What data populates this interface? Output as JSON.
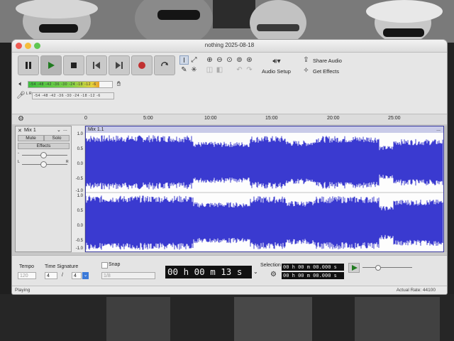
{
  "window": {
    "title": "nothing 2025-08-18"
  },
  "transport": {
    "pause": "pause-icon",
    "play": "play-icon",
    "stop": "stop-icon",
    "skip_start": "skip-start-icon",
    "skip_end": "skip-end-icon",
    "record": "record-icon",
    "loop": "loop-icon"
  },
  "toolbar": {
    "audio_setup_label": "Audio Setup",
    "share_audio_label": "Share Audio",
    "get_effects_label": "Get Effects"
  },
  "meters": {
    "playback_ticks": "-54 -48 -42 -36 -30 -24 -18 -12 -6",
    "record_ticks": "-54 -48 -42 -36 -30 -24 -18 -12 -6",
    "playback_level": 0.85,
    "record_lr": "L R"
  },
  "ruler": {
    "ticks": [
      "0",
      "5:00",
      "10:00",
      "15:00",
      "20:00",
      "25:00"
    ]
  },
  "track": {
    "name": "Mix 1",
    "mute_label": "Mute",
    "solo_label": "Solo",
    "effects_label": "Effects",
    "menu_label": "...",
    "pan_left": "L",
    "pan_right": "R",
    "clip_name": "Mix 1.1",
    "clip_menu": "...",
    "scale": [
      "1.0",
      "0.5",
      "0.0",
      "-0.5",
      "-1.0"
    ]
  },
  "bottom": {
    "tempo_label": "Tempo",
    "tempo_value": "120",
    "time_signature_label": "Time Signature",
    "ts_numerator": "4",
    "ts_slash": "/",
    "ts_denominator": "4",
    "snap_label": "Snap",
    "snap_value": "1/8",
    "time_display": "00 h 00 m 13 s",
    "selection_label": "Selection",
    "selection_start": "00 h 00 m 00.000 s",
    "selection_end": "00 h 00 m 00.000 s"
  },
  "status": {
    "state": "Playing",
    "rate": "Actual Rate: 44100"
  },
  "colors": {
    "waveform": "#3a3ad0",
    "clip_border": "#3a3aa0",
    "clip_header": "#c9cbe8"
  }
}
